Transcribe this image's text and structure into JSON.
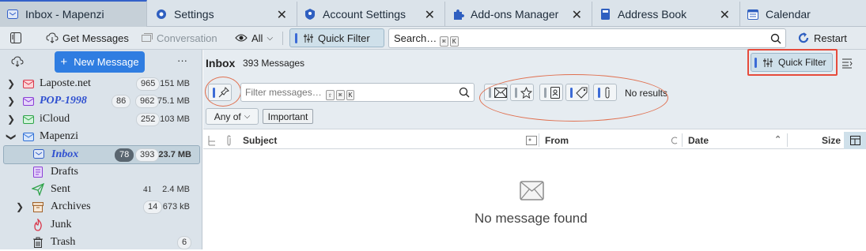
{
  "tabs": [
    {
      "label": "Inbox - Mapenzi",
      "icon": "mail-icon"
    },
    {
      "label": "Settings",
      "icon": "gear-icon"
    },
    {
      "label": "Account Settings",
      "icon": "account-icon"
    },
    {
      "label": "Add-ons Manager",
      "icon": "puzzle-icon"
    },
    {
      "label": "Address Book",
      "icon": "book-icon"
    },
    {
      "label": "Calendar",
      "icon": "calendar-icon"
    }
  ],
  "toolbar": {
    "get_messages": "Get Messages",
    "conversation": "Conversation",
    "all": "All",
    "quick_filter": "Quick Filter",
    "search_placeholder": "Search…",
    "restart": "Restart"
  },
  "sidebar": {
    "new_message": "New Message",
    "more": "···",
    "folders": [
      {
        "name": "Laposte.net",
        "count": "965",
        "size": "151 MB"
      },
      {
        "name": "POP-1998",
        "unread": "86",
        "count": "962",
        "size": "75.1 MB"
      },
      {
        "name": "iCloud",
        "count": "252",
        "size": "103 MB"
      },
      {
        "name": "Mapenzi"
      },
      {
        "name": "Inbox",
        "unread": "78",
        "count": "393",
        "size": "23.7 MB"
      },
      {
        "name": "Drafts"
      },
      {
        "name": "Sent",
        "count": "41",
        "size": "2.4 MB"
      },
      {
        "name": "Archives",
        "count": "14",
        "size": "673 kB"
      },
      {
        "name": "Junk"
      },
      {
        "name": "Trash",
        "count": "6"
      }
    ]
  },
  "header": {
    "folder": "Inbox",
    "count": "393 Messages",
    "quick_filter": "Quick Filter"
  },
  "filter": {
    "placeholder": "Filter messages…",
    "no_results": "No results",
    "any_of": "Any of",
    "important": "Important"
  },
  "columns": {
    "subject": "Subject",
    "from": "From",
    "date": "Date",
    "size": "Size"
  },
  "empty": {
    "text": "No message found"
  },
  "colors": {
    "accent": "#3461c9",
    "button_blue": "#2f7de1",
    "annotation": "#e07050"
  }
}
